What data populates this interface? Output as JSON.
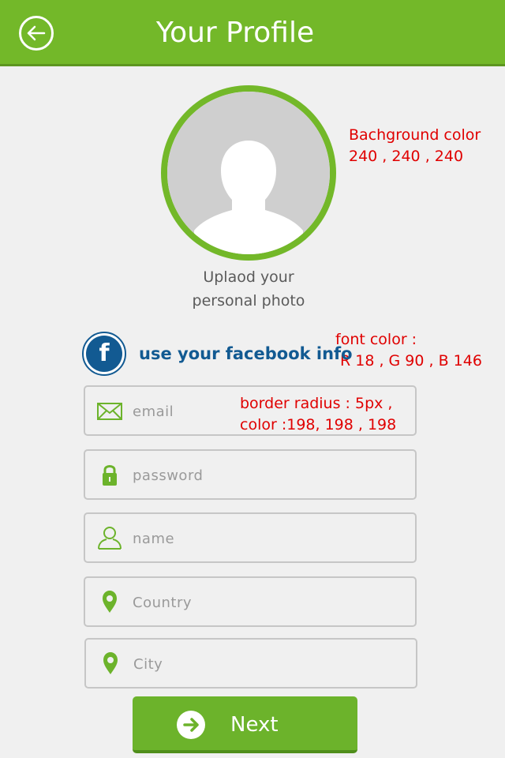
{
  "header": {
    "title": "Your Profile",
    "back_icon": "back-arrow-icon",
    "color": "#73b829"
  },
  "avatar": {
    "upload_label_line1": "Uplaod your",
    "upload_label_line2": "personal photo",
    "ring_color": "#73b829",
    "icon": "user-silhouette-icon"
  },
  "facebook": {
    "label": "use your facebook info",
    "icon_letter": "f",
    "color": "#125a92"
  },
  "notes": {
    "background_line1": "Bachground color",
    "background_line2": "240 , 240 , 240",
    "font_line1": "font color :",
    "font_line2": "R 18 , G 90 , B 146",
    "border_line1": "border radius : 5px ,",
    "border_line2": "color :198, 198 , 198"
  },
  "form": {
    "email": {
      "placeholder": "email",
      "value": "",
      "icon": "envelope-icon"
    },
    "password": {
      "placeholder": "password",
      "value": "",
      "icon": "lock-icon"
    },
    "name": {
      "placeholder": "name",
      "value": "",
      "icon": "user-icon"
    },
    "country": {
      "placeholder": "Country",
      "value": "",
      "icon": "location-pin-icon"
    },
    "city": {
      "placeholder": "City",
      "value": "",
      "icon": "location-pin-icon"
    }
  },
  "next_button": {
    "label": "Next",
    "icon": "arrow-right-icon",
    "color": "#6cb32b"
  },
  "colors": {
    "background": "#f0f0f0",
    "field_border": "#c6c6c6",
    "note_text": "#e00000"
  }
}
